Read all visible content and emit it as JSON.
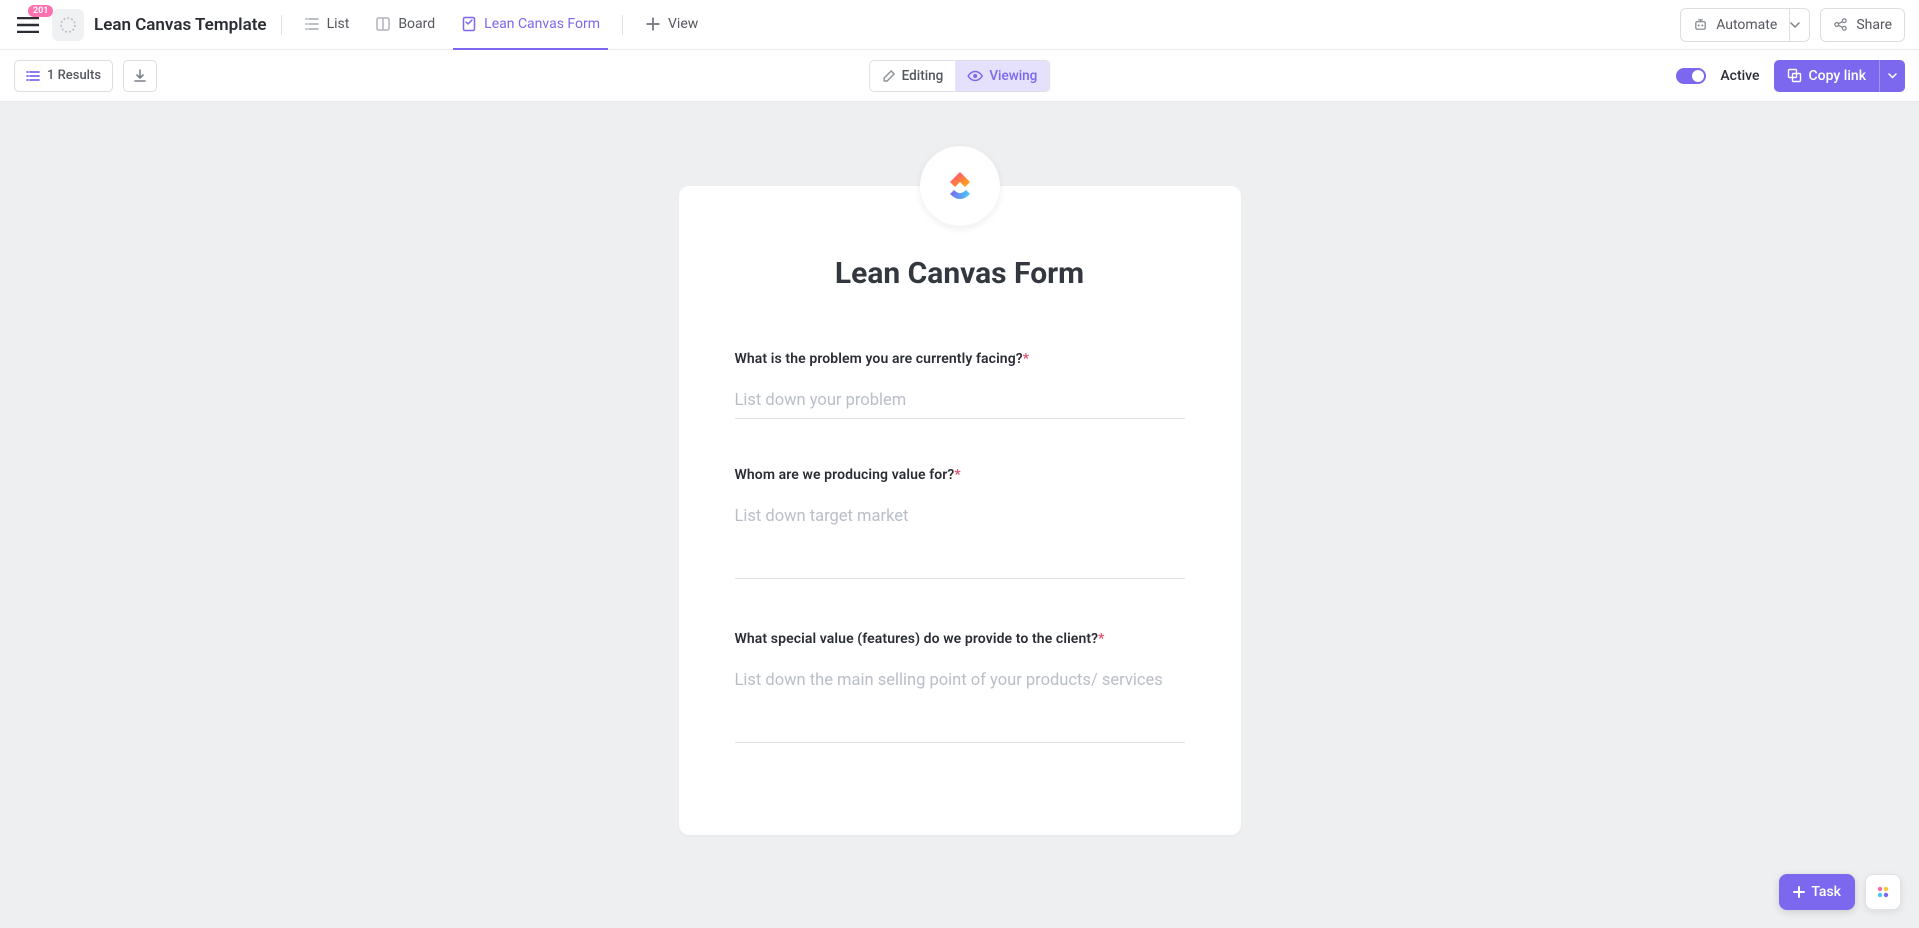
{
  "header": {
    "badge_count": "201",
    "page_title": "Lean Canvas Template",
    "tabs": {
      "list": "List",
      "board": "Board",
      "form": "Lean Canvas Form",
      "add_view": "View"
    },
    "automate": "Automate",
    "share": "Share"
  },
  "toolbar": {
    "results": "1 Results",
    "editing": "Editing",
    "viewing": "Viewing",
    "active": "Active",
    "copy_link": "Copy link"
  },
  "form": {
    "title": "Lean Canvas Form",
    "fields": [
      {
        "label": "What is the problem you are currently facing?",
        "placeholder": "List down your problem",
        "multiline": false
      },
      {
        "label": "Whom are we producing value for?",
        "placeholder": "List down target market",
        "multiline": true
      },
      {
        "label": "What special value (features) do we provide to the client?",
        "placeholder": "List down the main selling point of your products/ services",
        "multiline": true
      }
    ]
  },
  "floating": {
    "task": "Task"
  }
}
